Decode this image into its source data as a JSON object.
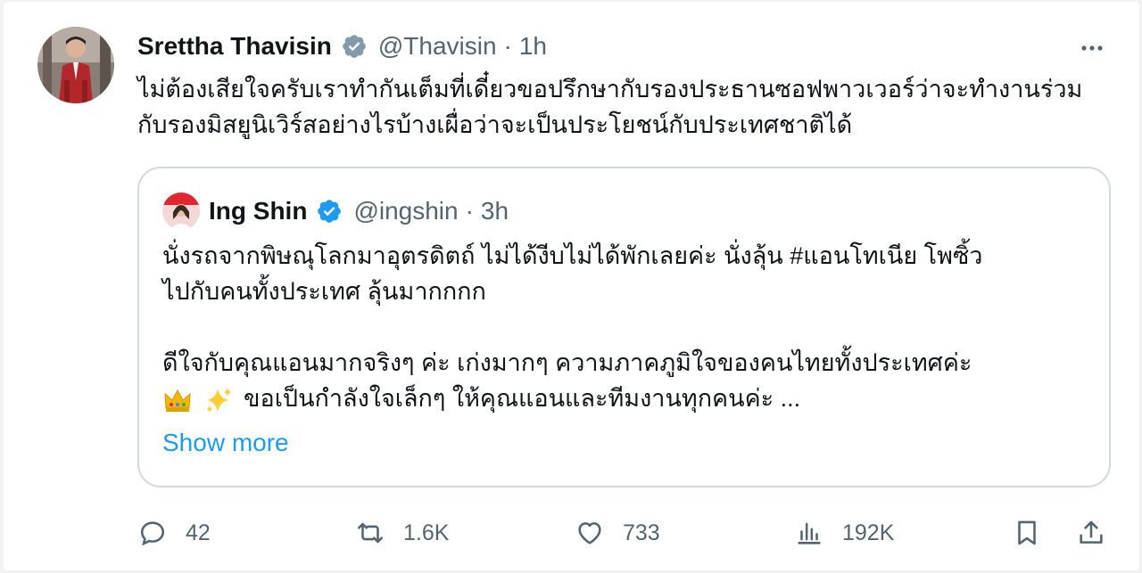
{
  "tweet": {
    "author_name": "Srettha Thavisin",
    "author_handle": "@Thavisin",
    "separator": "·",
    "time": "1h",
    "text": "ไม่ต้องเสียใจครับเราทำกันเต็มที่เดี๋ยวขอปรึกษากับรองประธานซอฟพาวเวอร์ว่าจะทำงานร่วมกับรองมิสยูนิเวิร์สอย่างไรบ้างเผื่อว่าจะเป็นประโยชน์กับประเทศชาติได้"
  },
  "quote": {
    "author_name": "Ing Shin",
    "author_handle": "@ingshin",
    "separator": "·",
    "time": "3h",
    "lines": [
      "นั่งรถจากพิษณุโลกมาอุตรดิตถ์ ไม่ได้งีบไม่ได้พักเลยค่ะ นั่งลุ้น #แอนโทเนีย โพซิ้ว",
      "ไปกับคนทั้งประเทศ ลุ้นมากกกก",
      "",
      "ดีใจกับคุณแอนมากจริงๆ ค่ะ เก่งมากๆ ความภาคภูมิใจของคนไทยทั้งประเทศค่ะ",
      "ขอเป็นกำลังใจเล็กๆ ให้คุณแอนและทีมงานทุกคนค่ะ ..."
    ],
    "emojis": [
      "crown-emoji",
      "sparkles-emoji"
    ],
    "show_more": "Show more"
  },
  "actions": {
    "replies": "42",
    "retweets": "1.6K",
    "likes": "733",
    "views": "192K"
  },
  "colors": {
    "verified": "#1d9bf0",
    "muted": "#536471",
    "border": "#cfd9de",
    "link": "#1d9bf0"
  },
  "icons": [
    "verified-badge-icon",
    "more-options-icon",
    "reply-icon",
    "retweet-icon",
    "like-icon",
    "views-icon",
    "bookmark-icon",
    "share-icon"
  ]
}
